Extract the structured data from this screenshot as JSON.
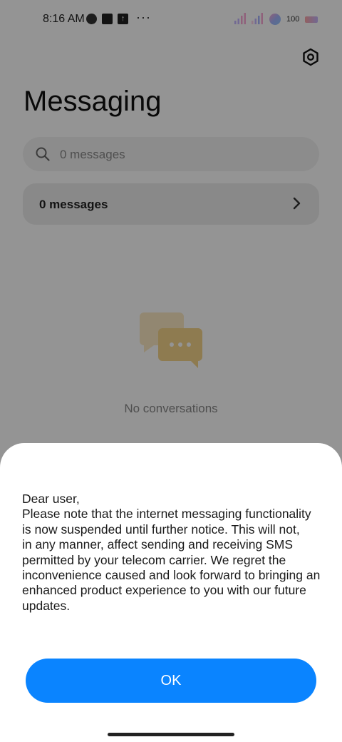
{
  "status_bar": {
    "time": "8:16 AM",
    "more_glyph": "···",
    "battery_level": "100",
    "icons": [
      "app-circle-icon",
      "app-square-icon",
      "upload-icon",
      "signal-icon",
      "signal-icon",
      "wifi-icon",
      "battery-icon"
    ]
  },
  "header": {
    "title": "Messaging",
    "settings_icon": "settings-hex-icon"
  },
  "search": {
    "placeholder": "0 messages",
    "value": ""
  },
  "messages_card": {
    "label": "0 messages"
  },
  "empty_state": {
    "text": "No conversations",
    "illustration": "chat-bubbles-icon"
  },
  "dialog": {
    "lines": [
      "Dear user,",
      "Please note that the internet messaging functionality",
      "is now suspended until further notice. This will not,",
      "in any manner, affect sending and receiving SMS",
      "permitted by your telecom carrier. We regret the",
      "inconvenience caused and look forward to bringing an",
      "enhanced product experience to you with our future",
      "updates."
    ],
    "ok_label": "OK"
  },
  "colors": {
    "accent": "#0a84ff",
    "scrim": "#000000",
    "illustration": "#f5d48a"
  }
}
